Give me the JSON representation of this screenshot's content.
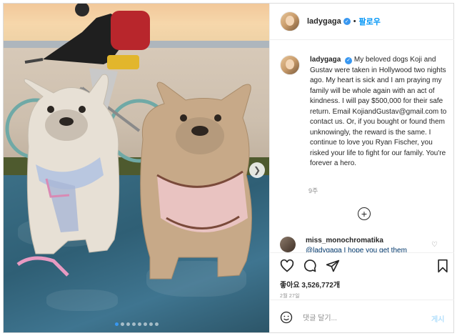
{
  "header": {
    "username": "ladygaga",
    "separator": "•",
    "follow_label": "팔로우"
  },
  "caption": {
    "username": "ladygaga",
    "text": "My beloved dogs Koji and Gustav were taken in Hollywood two nights ago. My heart is sick and I am praying my family will be whole again with an act of kindness. I will pay $500,000 for their safe return. Email KojiandGustav@gmail.com to contact us. Or, if you bought or found them unknowingly, the reward is the same. I continue to love you Ryan Fischer, you risked your life to fight for our family. You're forever a hero.",
    "time": "9주"
  },
  "comment": {
    "username": "miss_monochromatika",
    "text": "@ladygaga I hope you get them"
  },
  "post": {
    "likes": "좋아요 3,526,772개",
    "date": "2월 27일"
  },
  "comment_box": {
    "placeholder": "댓글 달기...",
    "post_label": "게시"
  },
  "carousel": {
    "total": 8,
    "active_index": 0
  },
  "icons": {
    "verified": "verified-badge-icon",
    "like": "heart-icon",
    "comment": "comment-icon",
    "share": "send-icon",
    "save": "bookmark-icon",
    "emoji": "emoji-icon",
    "more": "plus-circle-icon",
    "next": "chevron-right-icon"
  },
  "colors": {
    "accent": "#0095f6",
    "verified": "#3897f0",
    "muted": "#8e8e8e"
  }
}
